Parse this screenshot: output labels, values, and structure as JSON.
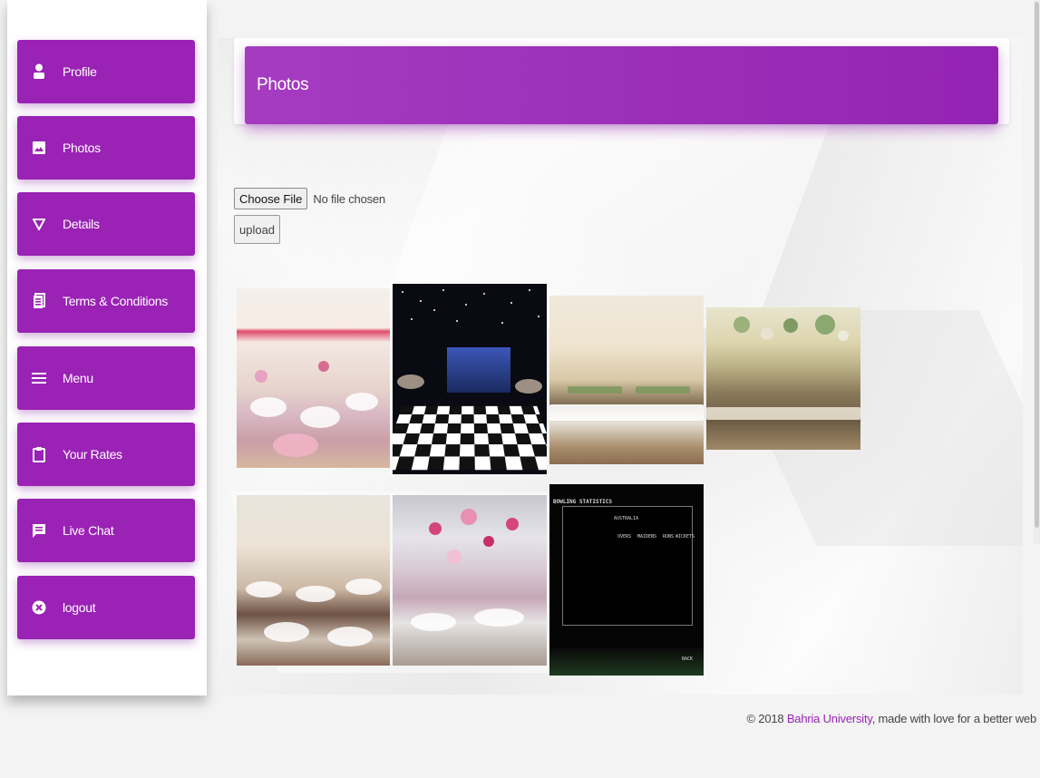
{
  "sidebar": {
    "items": [
      {
        "label": "Profile",
        "icon": "person-icon"
      },
      {
        "label": "Photos",
        "icon": "image-icon"
      },
      {
        "label": "Details",
        "icon": "triangle-down-icon"
      },
      {
        "label": "Terms & Conditions",
        "icon": "document-icon"
      },
      {
        "label": "Menu",
        "icon": "hamburger-icon"
      },
      {
        "label": "Your Rates",
        "icon": "clipboard-icon"
      },
      {
        "label": "Live Chat",
        "icon": "chat-icon"
      },
      {
        "label": "logout",
        "icon": "close-circle-icon"
      }
    ]
  },
  "header": {
    "title": "Photos"
  },
  "upload": {
    "choose_label": "Choose File",
    "file_status": "No file chosen",
    "upload_label": "upload"
  },
  "gallery": {
    "photos": [
      {
        "description": "pink marquee wedding reception"
      },
      {
        "description": "starlit marquee with checkered dance floor"
      },
      {
        "description": "bunting marquee with long tables"
      },
      {
        "description": "marquee with green paper lanterns"
      },
      {
        "description": "rustic marquee with hanging lanterns"
      },
      {
        "description": "marquee with pink paper lanterns"
      },
      {
        "description": "bowling statistics game screen"
      }
    ],
    "game_screen": {
      "heading": "BOWLING STATISTICS",
      "team": "AUSTRALIA",
      "columns": [
        "OVERS",
        "MAIDENS",
        "RUNS",
        "WICKETS"
      ],
      "footer": "BACK"
    }
  },
  "footer": {
    "prefix": "© 2018 ",
    "link": "Bahria University",
    "suffix": ", made with love for a better web"
  },
  "colors": {
    "accent": "#9a22b5"
  }
}
